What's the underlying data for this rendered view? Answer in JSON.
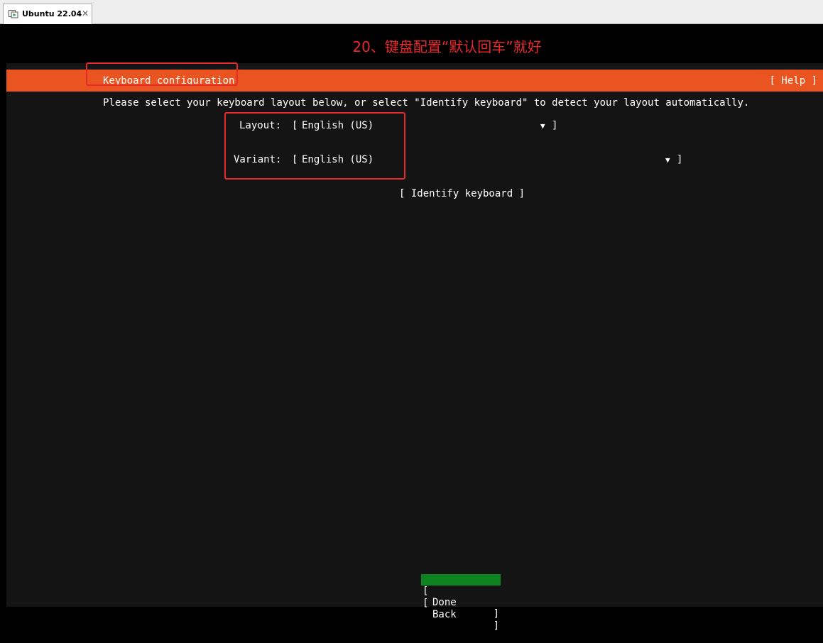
{
  "vm": {
    "tab_title": "Ubuntu 22.04",
    "close_glyph": "✕"
  },
  "annotation": {
    "caption": "20、键盘配置“默认回车”就好"
  },
  "installer": {
    "header_title": "Keyboard configuration",
    "help_label": "[ Help ]",
    "instruction": "Please select your keyboard layout below, or select \"Identify keyboard\" to detect your layout automatically.",
    "layout": {
      "label": "Layout:",
      "value": "English (US)"
    },
    "variant": {
      "label": "Variant:",
      "value": "English (US)"
    },
    "identify_button": "[ Identify keyboard ]",
    "done_button": "Done",
    "back_button": "Back",
    "bracket_open": "[",
    "bracket_close": "]",
    "dropdown_arrow": "▼"
  },
  "colors": {
    "header": "#e95420",
    "done_highlight": "#0e8420",
    "screen_bg": "#141414",
    "annotation_red": "#e8282b"
  }
}
